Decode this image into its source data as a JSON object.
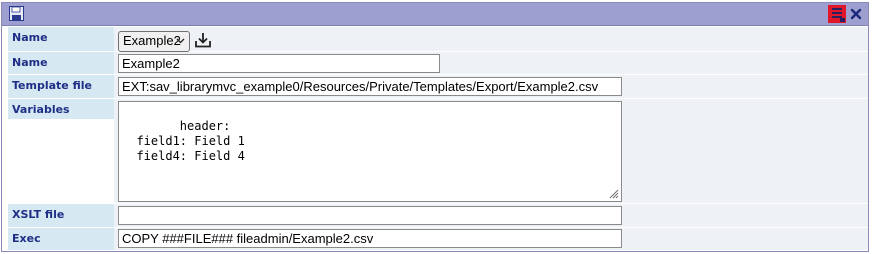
{
  "form": {
    "rows": [
      {
        "label": "Name",
        "type": "select",
        "value": "Example2"
      },
      {
        "label": "Name",
        "type": "text",
        "value": "Example2"
      },
      {
        "label": "Template file",
        "type": "text",
        "value": "EXT:sav_librarymvc_example0/Resources/Private/Templates/Export/Example2.csv"
      },
      {
        "label": "Variables",
        "type": "textarea",
        "value": "header:\n  field1: Field 1\n  field4: Field 4"
      },
      {
        "label": "XSLT file",
        "type": "text",
        "value": ""
      },
      {
        "label": "Exec",
        "type": "text",
        "value": "COPY ###FILE### fileadmin/Example2.csv"
      }
    ]
  },
  "icons": {
    "toolbar_left": "save-icon",
    "toolbar_right": [
      "export-icon",
      "close-icon"
    ],
    "select_action": "download-icon"
  },
  "colors": {
    "toolbar": "#9d9fd0",
    "label_bg": "#d6e8f2",
    "label_text": "#1f2f86",
    "value_bg": "#eef1f5"
  }
}
